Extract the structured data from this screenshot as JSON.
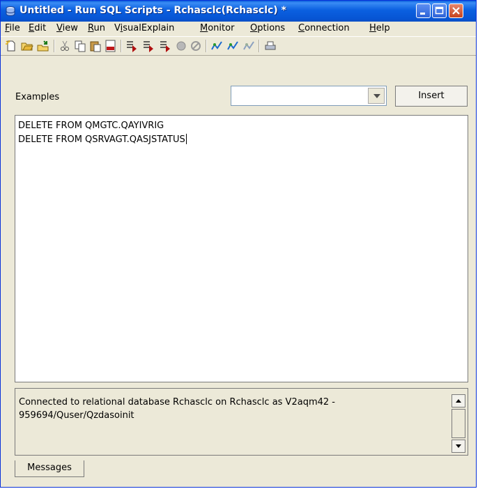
{
  "window": {
    "title": "Untitled - Run SQL Scripts - Rchasclc(Rchasclc) *"
  },
  "menu": {
    "items": [
      {
        "label": "File",
        "u": "F",
        "rest": "ile"
      },
      {
        "label": "Edit",
        "u": "E",
        "rest": "dit"
      },
      {
        "label": "View",
        "u": "V",
        "rest": "iew"
      },
      {
        "label": "Run",
        "u": "R",
        "rest": "un"
      },
      {
        "label": "VisualExplain",
        "pre": "V",
        "u": "i",
        "rest": "sualExplain"
      },
      {
        "label": "Monitor",
        "u": "M",
        "rest": "onitor"
      },
      {
        "label": "Options",
        "u": "O",
        "rest": "ptions"
      },
      {
        "label": "Connection",
        "u": "C",
        "rest": "onnection"
      },
      {
        "label": "Help",
        "u": "H",
        "rest": "elp"
      }
    ]
  },
  "toolbar": {
    "icons": [
      "new-script-icon",
      "open-icon",
      "save-icon",
      "cut-icon",
      "copy-icon",
      "paste-icon",
      "insert-sql-icon",
      "run-all-icon",
      "run-from-selected-icon",
      "run-selected-icon",
      "stop-icon",
      "cancel-icon",
      "explain-icon",
      "run-and-explain-icon",
      "explain-disabled-icon",
      "print-icon"
    ]
  },
  "examples": {
    "label": "Examples",
    "selected": "",
    "insert_label": "Insert"
  },
  "editor": {
    "lines": [
      "DELETE FROM QMGTC.QAYIVRIG",
      "DELETE FROM QSRVAGT.QASJSTATUS"
    ]
  },
  "messages": {
    "line1": "Connected to relational database Rchasclc on Rchasclc as V2aqm42 -",
    "line2": "959694/Quser/Qzdasoinit",
    "tab_label": "Messages"
  },
  "colors": {
    "titlebar": "#0b60e0",
    "chrome": "#ece9d8",
    "close_button": "#c6431e"
  }
}
